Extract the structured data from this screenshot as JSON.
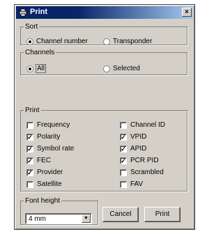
{
  "window": {
    "title": "Print",
    "close_glyph": "×",
    "icon": "printer-icon"
  },
  "sort": {
    "legend": "Sort",
    "options": [
      {
        "label": "Channel number",
        "selected": true
      },
      {
        "label": "Transponder",
        "selected": false
      }
    ]
  },
  "channels": {
    "legend": "Channels",
    "options": [
      {
        "label": "All",
        "selected": true
      },
      {
        "label": "Selected",
        "selected": false
      }
    ]
  },
  "print": {
    "legend": "Print",
    "left": [
      {
        "label": "Frequency",
        "checked": false
      },
      {
        "label": "Polarity",
        "checked": true
      },
      {
        "label": "Symbol rate",
        "checked": true
      },
      {
        "label": "FEC",
        "checked": true
      },
      {
        "label": "Provider",
        "checked": true
      },
      {
        "label": "Satellite",
        "checked": false
      }
    ],
    "right": [
      {
        "label": "Channel ID",
        "checked": false
      },
      {
        "label": "VPID",
        "checked": true
      },
      {
        "label": "APID",
        "checked": true
      },
      {
        "label": "PCR PID",
        "checked": true
      },
      {
        "label": "Scrambled",
        "checked": false
      },
      {
        "label": "FAV",
        "checked": false
      }
    ]
  },
  "font_height": {
    "legend": "Font height",
    "value": "4 mm",
    "arrow": "▼"
  },
  "buttons": {
    "cancel": "Cancel",
    "print": "Print"
  },
  "check_glyph": "✓"
}
